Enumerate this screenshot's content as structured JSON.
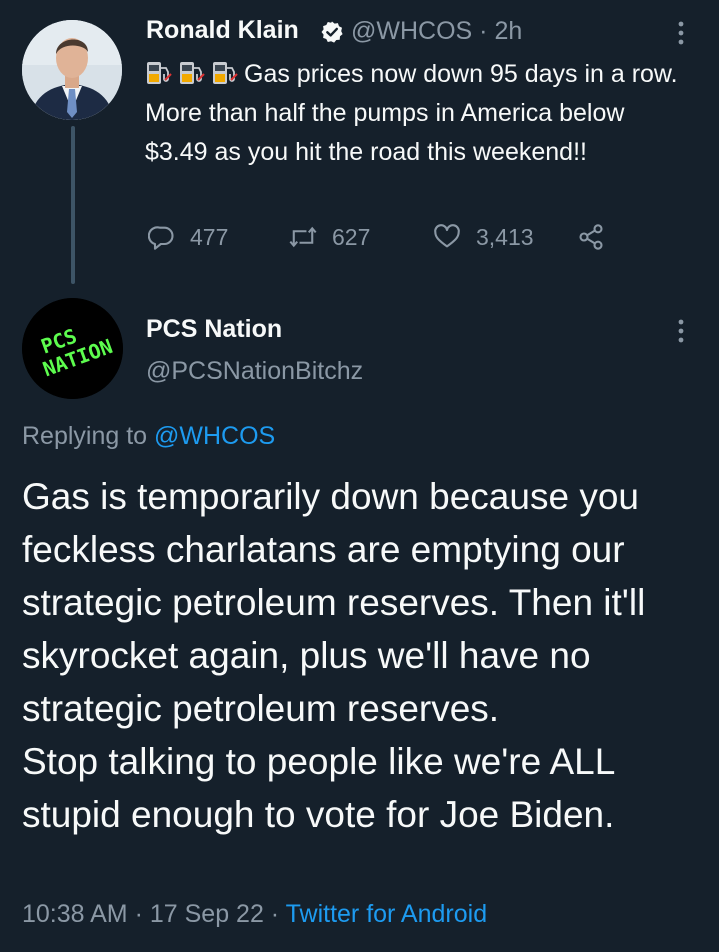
{
  "tweet": {
    "author_name": "Ronald Klain",
    "handle": "@WHCOS",
    "separator": " · ",
    "time_ago": "2h",
    "text": "Gas prices now down 95 days in a row.  More than half the pumps in America below $3.49 as you hit the road this weekend!!",
    "emoji_name": "fuel-pump-icon",
    "emoji_count": 3,
    "replies": "477",
    "retweets": "627",
    "likes": "3,413"
  },
  "reply": {
    "author_name": "PCS Nation",
    "handle": "@PCSNationBitchz",
    "avatar_text": "PCS NATION",
    "replying_prefix": "Replying to ",
    "replying_to": "@WHCOS",
    "text_paragraph_1": "Gas is temporarily down because you feckless charlatans are emptying our strategic petroleum reserves. Then it'll skyrocket again, plus we'll have no strategic petroleum reserves.",
    "text_paragraph_2": "Stop talking to people like we're ALL stupid enough to vote for Joe Biden.",
    "time": "10:38 AM",
    "date": "17 Sep 22",
    "source": "Twitter for Android",
    "meta_sep": " · "
  },
  "colors": {
    "background": "#15202b",
    "text": "#f7f9f9",
    "muted": "#8b98a5",
    "accent": "#1d9bf0",
    "avatar_text": "#5dfc4e"
  }
}
